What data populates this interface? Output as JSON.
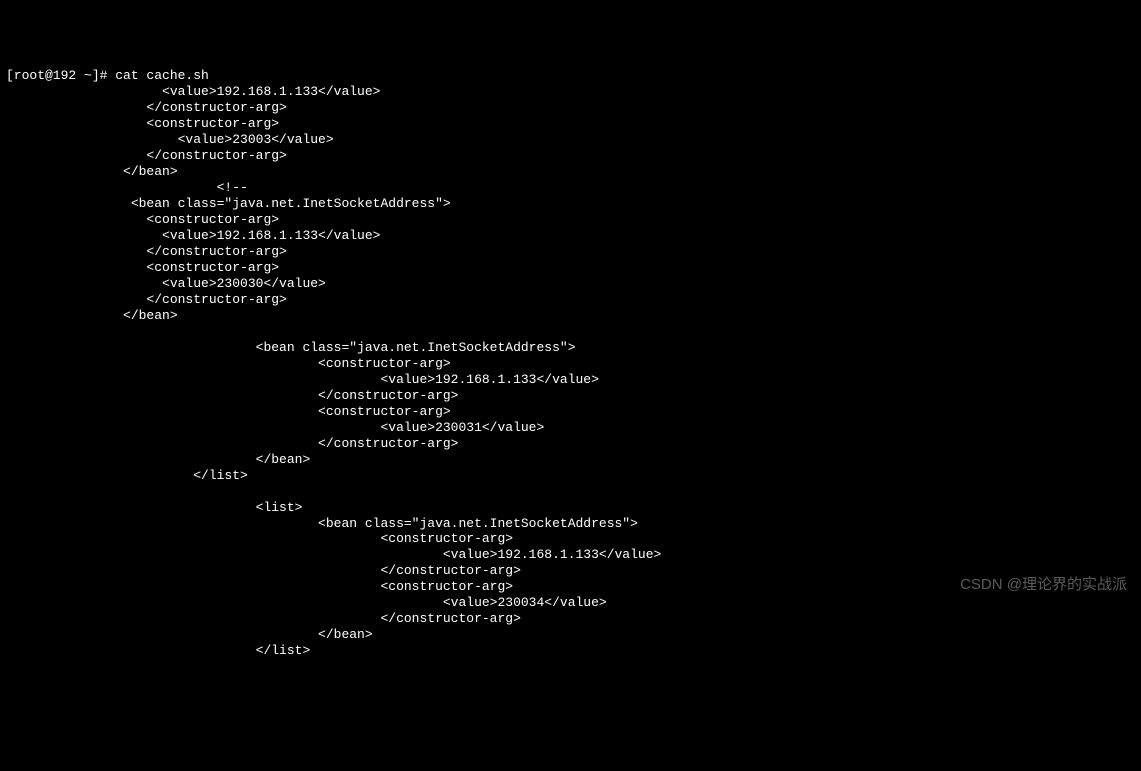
{
  "prompt": "[root@192 ~]# cat cache.sh",
  "lines": [
    "                    <value>192.168.1.133</value>",
    "                  </constructor-arg>",
    "                  <constructor-arg>",
    "                      <value>23003</value>",
    "                  </constructor-arg>",
    "               </bean>",
    "                           <!--",
    "                <bean class=\"java.net.InetSocketAddress\">",
    "                  <constructor-arg>",
    "                    <value>192.168.1.133</value>",
    "                  </constructor-arg>",
    "                  <constructor-arg>",
    "                    <value>230030</value>",
    "                  </constructor-arg>",
    "               </bean>",
    "",
    "                                <bean class=\"java.net.InetSocketAddress\">",
    "                                        <constructor-arg>",
    "                                                <value>192.168.1.133</value>",
    "                                        </constructor-arg>",
    "                                        <constructor-arg>",
    "                                                <value>230031</value>",
    "                                        </constructor-arg>",
    "                                </bean>",
    "                        </list>",
    "",
    "                                <list>",
    "                                        <bean class=\"java.net.InetSocketAddress\">",
    "                                                <constructor-arg>",
    "                                                        <value>192.168.1.133</value>",
    "                                                </constructor-arg>",
    "                                                <constructor-arg>",
    "                                                        <value>230034</value>",
    "                                                </constructor-arg>",
    "                                        </bean>",
    "                                </list>"
  ],
  "watermark": "CSDN @理论界的实战派"
}
